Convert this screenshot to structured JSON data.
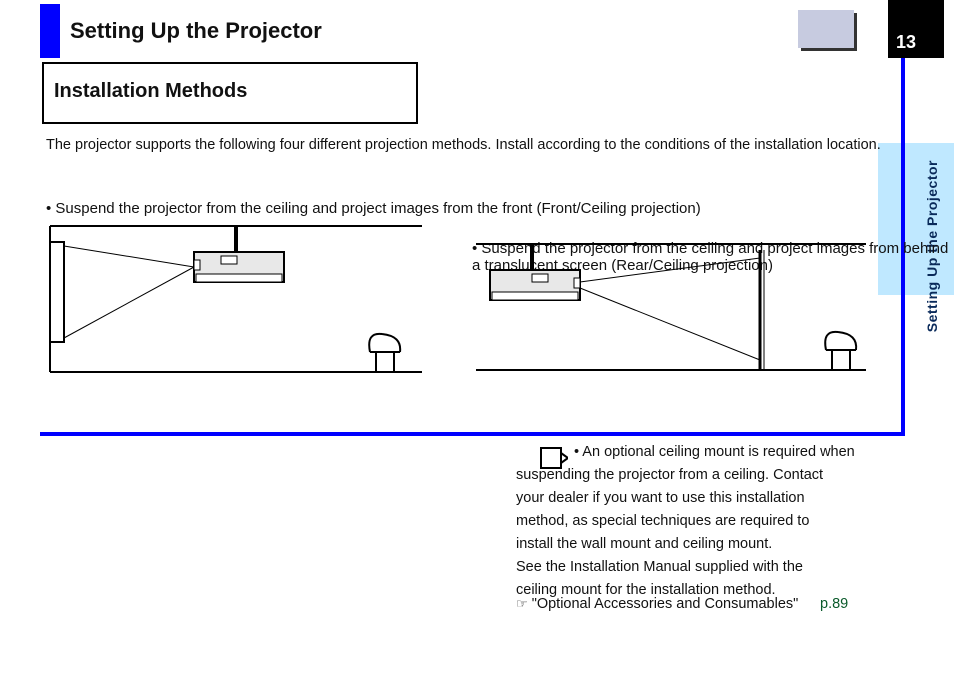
{
  "header": {
    "title": "Setting Up the Projector",
    "page_number": "13"
  },
  "side_tab": "Setting Up the Projector",
  "panel": {
    "title": "Installation Methods"
  },
  "intro": "The projector supports the following four different projection methods. Install according to the conditions of the installation location.",
  "figures": {
    "left_caption": "• Suspend the projector from the ceiling and project images from the front (Front/Ceiling projection)",
    "right_caption": "• Suspend the projector from the ceiling and project images from behind a translucent screen (Rear/Ceiling projection)"
  },
  "tip": {
    "lines": [
      "• An optional ceiling mount is required when",
      "suspending the projector from a ceiling. Contact",
      "your dealer if you want to use this installation",
      "method, as special techniques are required to",
      "install the wall mount and ceiling mount.",
      "See the Installation Manual supplied with the",
      "ceiling mount for the installation method."
    ]
  },
  "reference": {
    "label": "\"Optional Accessories and Consumables\"",
    "page": "p.89"
  }
}
